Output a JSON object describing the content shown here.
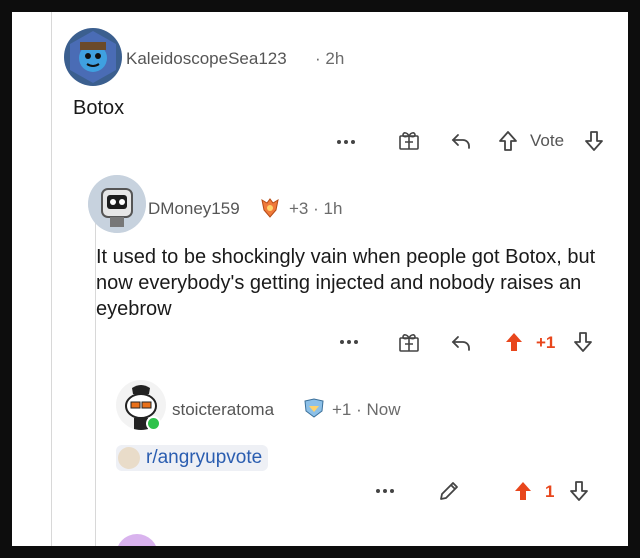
{
  "comments": [
    {
      "username": "KaleidoscopeSea123",
      "meta": "· 2h",
      "body": "Botox",
      "vote_label": "Vote"
    },
    {
      "username": "DMoney159",
      "meta": "+3 · 1h",
      "body": "It used to be shockingly vain when people got Botox, but now everybody's getting injected and nobody raises an eyebrow",
      "score": "+1"
    },
    {
      "username": "stoicteratoma",
      "meta": "+1 · Now",
      "subreddit": "r/angryupvote",
      "score": "1"
    }
  ],
  "icons": {
    "more": "more-icon",
    "award": "award-icon",
    "reply": "reply-icon",
    "upvote": "upvote-icon",
    "downvote": "downvote-icon",
    "edit": "edit-icon"
  },
  "colors": {
    "upvote_active": "#e8461c",
    "link": "#2a5db0",
    "online": "#2ec24a"
  }
}
